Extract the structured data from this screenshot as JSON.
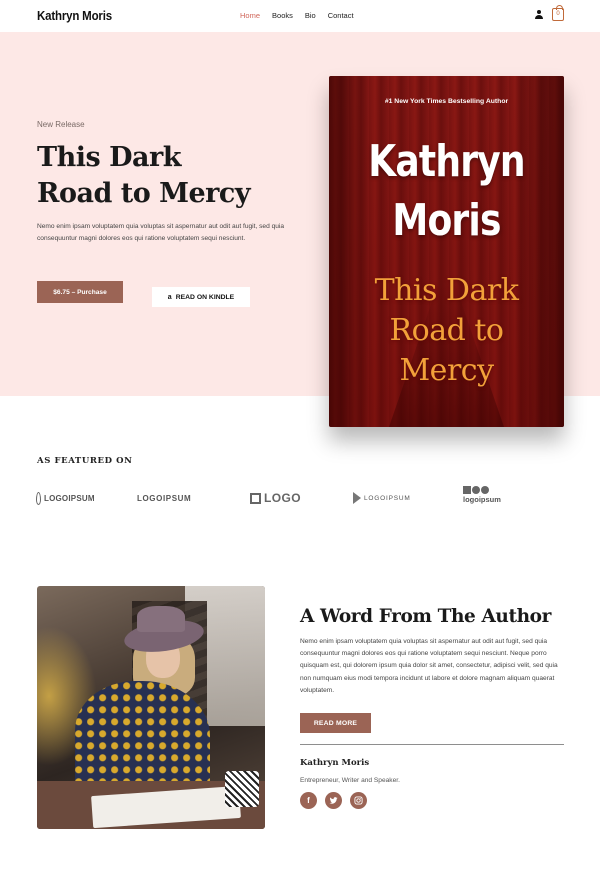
{
  "header": {
    "brand": "Kathryn Moris",
    "nav": [
      {
        "label": "Home"
      },
      {
        "label": "Books"
      },
      {
        "label": "Bio"
      },
      {
        "label": "Contact"
      }
    ],
    "cart_count": "0",
    "icons": [
      "user-icon",
      "shopping-bag-icon"
    ]
  },
  "hero": {
    "kicker": "New Release",
    "title_line1": "This Dark",
    "title_line2": "Road to Mercy",
    "description": "Nemo enim ipsam voluptatem quia voluptas sit aspernatur aut odit aut fugit, sed quia consequuntur magni dolores eos qui ratione voluptatem sequi nesciunt.",
    "purchase_label": "$6.75 – Purchase",
    "kindle_label": "READ ON KINDLE",
    "book": {
      "tagline": "#1 New York Times Bestselling Author",
      "author_line1": "Kathryn",
      "author_line2": "Moris",
      "title_line1": "This Dark",
      "title_line2": "Road to",
      "title_line3": "Mercy"
    }
  },
  "featured": {
    "heading": "AS FEATURED ON",
    "logos": [
      "LOGOIPSUM",
      "LOGOIPSUM",
      "LOGO",
      "LOGOIPSUM",
      "logoipsum"
    ]
  },
  "author_section": {
    "title": "A Word From The Author",
    "text": "Nemo enim ipsam voluptatem quia voluptas sit aspernatur aut odit aut fugit, sed quia consequuntur magni dolores eos qui ratione voluptatem sequi nesciunt. Neque porro quisquam est, qui dolorem ipsum quia dolor sit amet, consectetur, adipisci velit, sed quia non numquam eius modi tempora incidunt ut labore et dolore magnam aliquam quaerat voluptatem.",
    "read_more_label": "READ MORE",
    "signature_name": "Kathryn Moris",
    "signature_role": "Entrepreneur, Writer and Speaker.",
    "socials": [
      "facebook-icon",
      "twitter-icon",
      "instagram-icon"
    ]
  },
  "colors": {
    "accent": "#9b6455",
    "hero_bg": "#fde8e6",
    "nav_active": "#d0665a",
    "book_red": "#861916",
    "book_title_orange": "#f2a13a"
  }
}
